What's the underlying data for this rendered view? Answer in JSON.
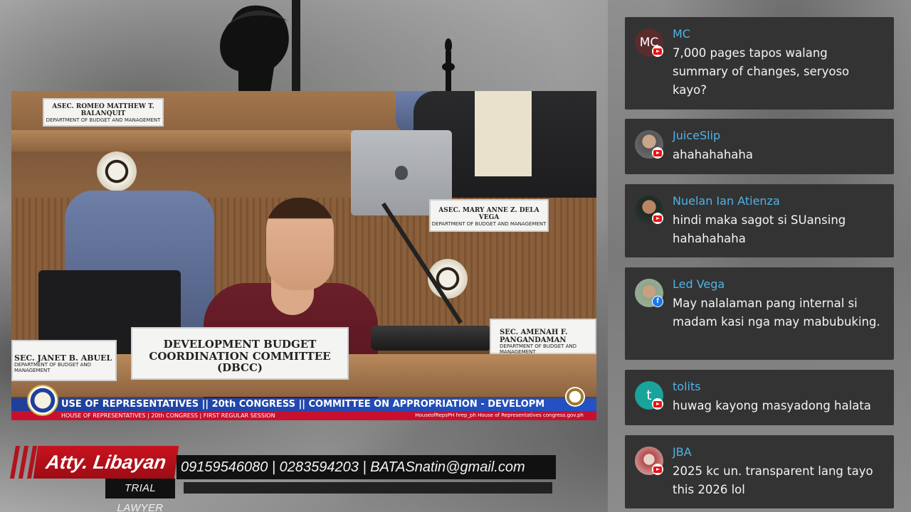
{
  "video": {
    "nameplates": {
      "top_left": {
        "name": "ASEC. ROMEO MATTHEW T. BALANQUIT",
        "dept": "DEPARTMENT OF BUDGET AND MANAGEMENT"
      },
      "mid_right": {
        "name": "ASEC. MARY ANNE Z. DELA VEGA",
        "dept": "DEPARTMENT OF BUDGET AND MANAGEMENT"
      },
      "center": {
        "line1": "DEVELOPMENT BUDGET",
        "line2": "COORDINATION COMMITTEE (DBCC)"
      },
      "left": {
        "name": "SEC. JANET B. ABUEL",
        "dept": "DEPARTMENT OF BUDGET AND MANAGEMENT"
      },
      "right": {
        "name": "SEC. AMENAH F. PANGANDAMAN",
        "dept": "DEPARTMENT OF BUDGET AND MANAGEMENT"
      }
    },
    "ticker_top": "USE OF REPRESENTATIVES   ||   20th CONGRESS   ||   COMMITTEE ON APPROPRIATION - DEVELOPM",
    "ticker_bottom": "HOUSE OF REPRESENTATIVES  |  20th CONGRESS  |  FIRST REGULAR SESSION",
    "ticker_socials": "HouseofRepsPH   hrep_ph   House of Representatives   congress.gov.ph"
  },
  "lower_third": {
    "name": "Atty. Libayan",
    "title": "TRIAL LAWYER",
    "contact": "09159546080 | 0283594203 | BATASnatin@gmail.com",
    "accent_color": "#c8131e"
  },
  "chat": {
    "messages": [
      {
        "author": "MC",
        "text": "7,000 pages tapos walang summary of changes, seryoso kayo?",
        "platform": "youtube",
        "avatar_initials": "MC",
        "avatar_color": "#5a2c2c"
      },
      {
        "author": "JuiceSlip",
        "text": "ahahahahaha",
        "platform": "youtube",
        "avatar_initials": "",
        "avatar_color": "#6b6b6b"
      },
      {
        "author": "Nuelan Ian Atienza",
        "text": "hindi maka sagot si SUansing hahahahaha",
        "platform": "youtube",
        "avatar_initials": "",
        "avatar_color": "#3a3a3a"
      },
      {
        "author": "Led Vega",
        "text": "May nalalaman pang internal si madam kasi nga may mabubuking.",
        "platform": "facebook",
        "avatar_initials": "",
        "avatar_color": "#7b8b7a"
      },
      {
        "author": "tolits",
        "text": "huwag kayong masyadong halata",
        "platform": "youtube",
        "avatar_initials": "t",
        "avatar_color": "#1aa39a"
      },
      {
        "author": "JBA",
        "text": "2025 kc un. transparent lang tayo this 2026 lol",
        "platform": "youtube",
        "avatar_initials": "",
        "avatar_color": "#c9a6a6"
      }
    ],
    "author_color": "#4fb3e6"
  }
}
